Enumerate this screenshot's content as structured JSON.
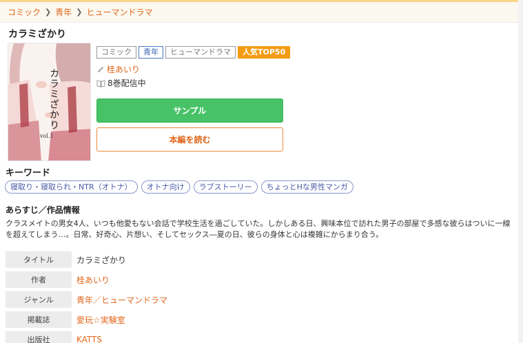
{
  "breadcrumb": [
    {
      "label": "コミック"
    },
    {
      "label": "青年"
    },
    {
      "label": "ヒューマンドラマ"
    }
  ],
  "title": "カラミざかり",
  "cover": {
    "alt": "カラミざかり vol.1",
    "title_text": "カラミざかり",
    "volume_text": "vol.1"
  },
  "tags": [
    "コミック",
    "青年",
    "ヒューマンドラマ",
    "人気TOP50"
  ],
  "author": "桂あいり",
  "volumes": "8巻配信中",
  "buttons": {
    "sample": "サンプル",
    "read": "本編を読む"
  },
  "keywords": {
    "title": "キーワード",
    "items": [
      "寝取り・寝取られ・NTR（オトナ）",
      "オトナ向け",
      "ラブストーリー",
      "ちょっとHな男性マンガ"
    ]
  },
  "synopsis": {
    "title": "あらすじ／作品情報",
    "text": "クラスメイトの男女4人、いつも他愛もない会話で学校生活を過ごしていた。しかしある日、興味本位で訪れた男子の部屋で多感な彼らはついに一線を超えてしまう…。日常、好奇心、片想い、そしてセックス―夏の日、彼らの身体と心は複雑にからまり合う。"
  },
  "info": [
    {
      "label": "タイトル",
      "value": "カラミざかり"
    },
    {
      "label": "作者",
      "value": "桂あいり"
    },
    {
      "label": "ジャンル",
      "value": "青年／ヒューマンドラマ"
    },
    {
      "label": "掲載誌",
      "value": "愛玩☆実験室"
    },
    {
      "label": "出版社",
      "value": "KATTS"
    }
  ],
  "colors": {
    "accent": "#e0671c",
    "sample_green": "#47c266",
    "popular_orange": "#f39c12",
    "keyword_blue": "#4a5aa6"
  }
}
